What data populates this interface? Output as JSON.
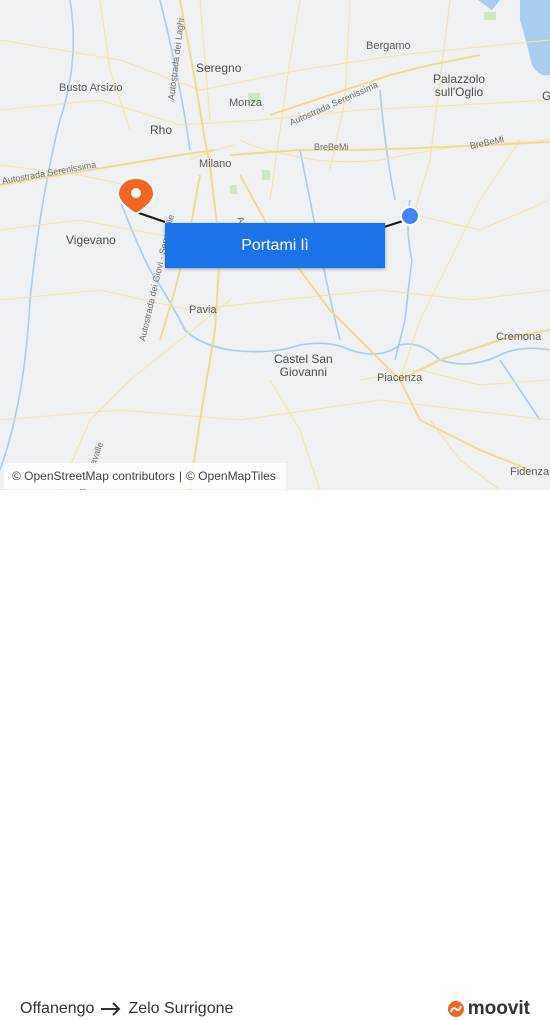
{
  "map": {
    "places": [
      {
        "id": "bergamo",
        "name": "Bergamo"
      },
      {
        "id": "seregno",
        "name": "Seregno"
      },
      {
        "id": "busto",
        "name": "Busto Arsizio"
      },
      {
        "id": "monza",
        "name": "Monza"
      },
      {
        "id": "palazzolo",
        "name": "Palazzolo\nsull'Oglio"
      },
      {
        "id": "rho",
        "name": "Rho"
      },
      {
        "id": "milano",
        "name": "Milano"
      },
      {
        "id": "vigevano",
        "name": "Vigevano"
      },
      {
        "id": "pavia",
        "name": "Pavia"
      },
      {
        "id": "castel",
        "name": "Castel San\nGiovanni"
      },
      {
        "id": "piacenza",
        "name": "Piacenza"
      },
      {
        "id": "cremona",
        "name": "Cremona"
      },
      {
        "id": "fidenza",
        "name": "Fidenza"
      },
      {
        "id": "g_edge",
        "name": "G"
      }
    ],
    "roads": [
      {
        "id": "serenissima_ne",
        "name": "Autostrada Serenissima"
      },
      {
        "id": "serenissima_w",
        "name": "Autostrada Serenissima"
      },
      {
        "id": "brebemi_1",
        "name": "BreBeMi"
      },
      {
        "id": "brebemi_2",
        "name": "BreBeMi"
      },
      {
        "id": "autostrada_laghi",
        "name": "Autostrada dei Laghi"
      },
      {
        "id": "autostrada_serravalle",
        "name": "Autostrada dei Giovi - Serravalle"
      },
      {
        "id": "serravalle_sw",
        "name": "A - Serravalle"
      },
      {
        "id": "milano_road",
        "name": "Au"
      }
    ],
    "attribution": {
      "osm": "© OpenStreetMap contributors",
      "separator": "|",
      "omt": "© OpenMapTiles"
    },
    "button_label": "Portami lì"
  },
  "route": {
    "from": "Offanengo",
    "to": "Zelo Surrigone"
  },
  "brand": {
    "name": "moovit",
    "color": "#f26522"
  },
  "colors": {
    "primary": "#1a73e8",
    "origin_marker": "#4285f4",
    "destination_marker": "#f26522",
    "roads": "#f7e4a0",
    "water": "#a8cdee",
    "route_line": "#1a1a1a"
  }
}
